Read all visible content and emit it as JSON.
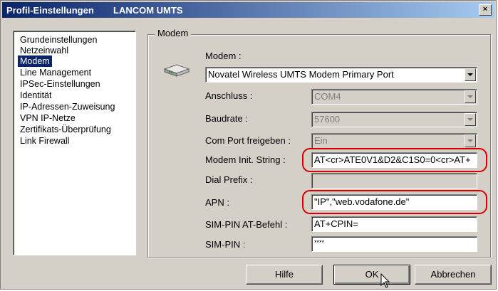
{
  "window": {
    "title": "Profil-Einstellungen",
    "subtitle": "LANCOM UMTS",
    "close_glyph": "×"
  },
  "sidebar": {
    "items": [
      {
        "label": "Grundeinstellungen",
        "selected": false
      },
      {
        "label": "Netzeinwahl",
        "selected": false
      },
      {
        "label": "Modem",
        "selected": true
      },
      {
        "label": "Line Management",
        "selected": false
      },
      {
        "label": "IPSec-Einstellungen",
        "selected": false
      },
      {
        "label": "Identität",
        "selected": false
      },
      {
        "label": "IP-Adressen-Zuweisung",
        "selected": false
      },
      {
        "label": "VPN IP-Netze",
        "selected": false
      },
      {
        "label": "Zertifikats-Überprüfung",
        "selected": false
      },
      {
        "label": "Link Firewall",
        "selected": false
      }
    ]
  },
  "group": {
    "title": "Modem",
    "modem_label": "Modem :",
    "modem_value": "Novatel Wireless UMTS Modem Primary Port",
    "anschluss_label": "Anschluss :",
    "anschluss_value": "COM4",
    "baudrate_label": "Baudrate :",
    "baudrate_value": "57600",
    "comport_label": "Com Port freigeben :",
    "comport_value": "Ein",
    "init_label": "Modem Init. String :",
    "init_value": "AT<cr>ATE0V1&D2&C1S0=0<cr>AT+",
    "dial_label": "Dial Prefix :",
    "dial_value": "",
    "apn_label": "APN :",
    "apn_value": "\"IP\",\"web.vodafone.de\"",
    "simat_label": "SIM-PIN AT-Befehl :",
    "simat_value": "AT+CPIN=",
    "simpin_label": "SIM-PIN :",
    "simpin_value": "****"
  },
  "buttons": {
    "help": "Hilfe",
    "ok": "OK",
    "cancel": "Abbrechen"
  },
  "colors": {
    "highlight_ring": "#d40000",
    "selection": "#0a246a",
    "dialog_bg": "#d4d0c8"
  }
}
